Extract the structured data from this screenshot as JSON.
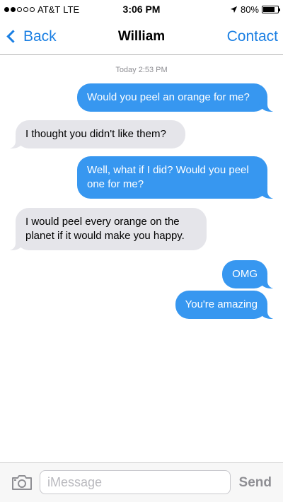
{
  "status_bar": {
    "carrier": "AT&T",
    "network": "LTE",
    "time": "3:06 PM",
    "battery_percent": "80%",
    "battery_level": 0.8,
    "signal_bars_filled": 2,
    "signal_bars_total": 5
  },
  "nav": {
    "back_label": "Back",
    "title": "William",
    "contact_label": "Contact"
  },
  "thread": {
    "timestamp": "Today 2:53 PM",
    "messages": [
      {
        "direction": "out",
        "text": "Would you peel an orange for me?"
      },
      {
        "direction": "in",
        "text": "I thought you didn't like them?"
      },
      {
        "direction": "out",
        "text": "Well, what if I did? Would you peel one for me?"
      },
      {
        "direction": "in",
        "text": "I would peel every orange on the planet if it would make you happy."
      },
      {
        "direction": "out",
        "text": "OMG"
      },
      {
        "direction": "out",
        "text": "You're amazing"
      }
    ]
  },
  "composer": {
    "placeholder": "iMessage",
    "value": "",
    "send_label": "Send",
    "camera_icon": "camera-icon"
  },
  "colors": {
    "accent": "#1a7fe3",
    "outgoing_bubble": "#3797f0",
    "incoming_bubble": "#e5e5ea"
  }
}
